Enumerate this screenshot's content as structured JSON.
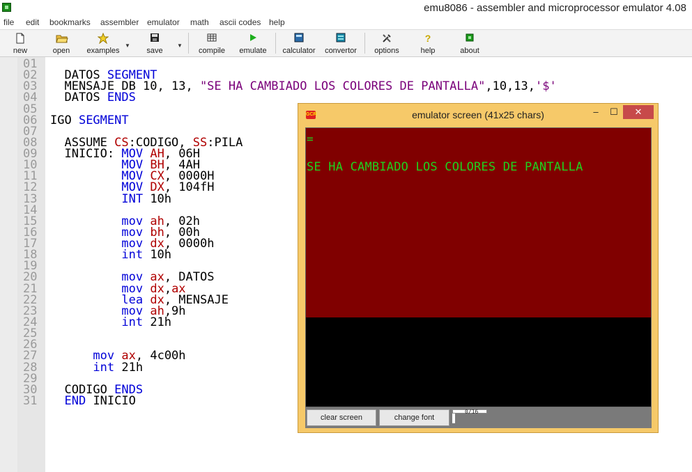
{
  "window": {
    "title": "emu8086 - assembler and microprocessor emulator 4.08"
  },
  "menu": [
    "file",
    "edit",
    "bookmarks",
    "assembler",
    "emulator",
    "math",
    "ascii codes",
    "help"
  ],
  "toolbar": {
    "new": "new",
    "open": "open",
    "examples": "examples",
    "save": "save",
    "compile": "compile",
    "emulate": "emulate",
    "calculator": "calculator",
    "convertor": "convertor",
    "options": "options",
    "help": "help",
    "about": "about"
  },
  "editor": {
    "line_numbers": [
      "01",
      "02",
      "03",
      "04",
      "05",
      "06",
      "07",
      "08",
      "09",
      "10",
      "11",
      "12",
      "13",
      "14",
      "15",
      "16",
      "17",
      "18",
      "19",
      "20",
      "21",
      "22",
      "23",
      "24",
      "25",
      "26",
      "27",
      "28",
      "29",
      "30",
      "31"
    ],
    "lines": [
      [],
      [
        [
          "  DATOS ",
          ""
        ],
        [
          "SEGMENT",
          "blue"
        ]
      ],
      [
        [
          "  MENSAJE DB 10, 13, ",
          ""
        ],
        [
          "\"SE HA CAMBIADO LOS COLORES DE PANTALLA\"",
          "str"
        ],
        [
          ",10,13,",
          ""
        ],
        [
          "'$'",
          "str"
        ]
      ],
      [
        [
          "  DATOS ",
          ""
        ],
        [
          "ENDS",
          "blue"
        ]
      ],
      [],
      [
        [
          "IGO ",
          ""
        ],
        [
          "SEGMENT",
          "blue"
        ]
      ],
      [],
      [
        [
          "  ASSUME ",
          ""
        ],
        [
          "CS",
          "red"
        ],
        [
          ":CODIGO, ",
          ""
        ],
        [
          "SS",
          "red"
        ],
        [
          ":PILA",
          ""
        ]
      ],
      [
        [
          "  INICIO: ",
          ""
        ],
        [
          "MOV",
          "blue"
        ],
        [
          " ",
          ""
        ],
        [
          "AH",
          "red"
        ],
        [
          ", 06H",
          ""
        ]
      ],
      [
        [
          "          ",
          ""
        ],
        [
          "MOV",
          "blue"
        ],
        [
          " ",
          ""
        ],
        [
          "BH",
          "red"
        ],
        [
          ", 4AH",
          ""
        ]
      ],
      [
        [
          "          ",
          ""
        ],
        [
          "MOV",
          "blue"
        ],
        [
          " ",
          ""
        ],
        [
          "CX",
          "red"
        ],
        [
          ", 0000H",
          ""
        ]
      ],
      [
        [
          "          ",
          ""
        ],
        [
          "MOV",
          "blue"
        ],
        [
          " ",
          ""
        ],
        [
          "DX",
          "red"
        ],
        [
          ", 104fH",
          ""
        ]
      ],
      [
        [
          "          ",
          ""
        ],
        [
          "INT",
          "blue"
        ],
        [
          " 10h",
          ""
        ]
      ],
      [],
      [
        [
          "          ",
          ""
        ],
        [
          "mov",
          "blue"
        ],
        [
          " ",
          ""
        ],
        [
          "ah",
          "red"
        ],
        [
          ", 02h",
          ""
        ]
      ],
      [
        [
          "          ",
          ""
        ],
        [
          "mov",
          "blue"
        ],
        [
          " ",
          ""
        ],
        [
          "bh",
          "red"
        ],
        [
          ", 00h",
          ""
        ]
      ],
      [
        [
          "          ",
          ""
        ],
        [
          "mov",
          "blue"
        ],
        [
          " ",
          ""
        ],
        [
          "dx",
          "red"
        ],
        [
          ", 0000h",
          ""
        ]
      ],
      [
        [
          "          ",
          ""
        ],
        [
          "int",
          "blue"
        ],
        [
          " 10h",
          ""
        ]
      ],
      [],
      [
        [
          "          ",
          ""
        ],
        [
          "mov",
          "blue"
        ],
        [
          " ",
          ""
        ],
        [
          "ax",
          "red"
        ],
        [
          ", DATOS",
          ""
        ]
      ],
      [
        [
          "          ",
          ""
        ],
        [
          "mov",
          "blue"
        ],
        [
          " ",
          ""
        ],
        [
          "dx",
          "red"
        ],
        [
          ",",
          ""
        ],
        [
          "ax",
          "red"
        ]
      ],
      [
        [
          "          ",
          ""
        ],
        [
          "lea",
          "blue"
        ],
        [
          " ",
          ""
        ],
        [
          "dx",
          "red"
        ],
        [
          ", MENSAJE",
          ""
        ]
      ],
      [
        [
          "          ",
          ""
        ],
        [
          "mov",
          "blue"
        ],
        [
          " ",
          ""
        ],
        [
          "ah",
          "red"
        ],
        [
          ",9h",
          ""
        ]
      ],
      [
        [
          "          ",
          ""
        ],
        [
          "int",
          "blue"
        ],
        [
          " 21h",
          ""
        ]
      ],
      [],
      [],
      [
        [
          "      ",
          ""
        ],
        [
          "mov",
          "blue"
        ],
        [
          " ",
          ""
        ],
        [
          "ax",
          "red"
        ],
        [
          ", 4c00h",
          ""
        ]
      ],
      [
        [
          "      ",
          ""
        ],
        [
          "int",
          "blue"
        ],
        [
          " 21h",
          ""
        ]
      ],
      [],
      [
        [
          "  CODIGO ",
          ""
        ],
        [
          "ENDS",
          "blue"
        ]
      ],
      [
        [
          "  ",
          ""
        ],
        [
          "END",
          "blue"
        ],
        [
          " INICIO",
          ""
        ]
      ]
    ]
  },
  "emulator_screen": {
    "title": "emulator screen (41x25 chars)",
    "cursor_text": "=",
    "message": "SE HA CAMBIADO LOS COLORES DE PANTALLA",
    "clear_label": "clear screen",
    "font_label": "change font",
    "page_indicator": "0/16",
    "colors": {
      "background": "#800000",
      "text": "#1fd21f"
    }
  }
}
